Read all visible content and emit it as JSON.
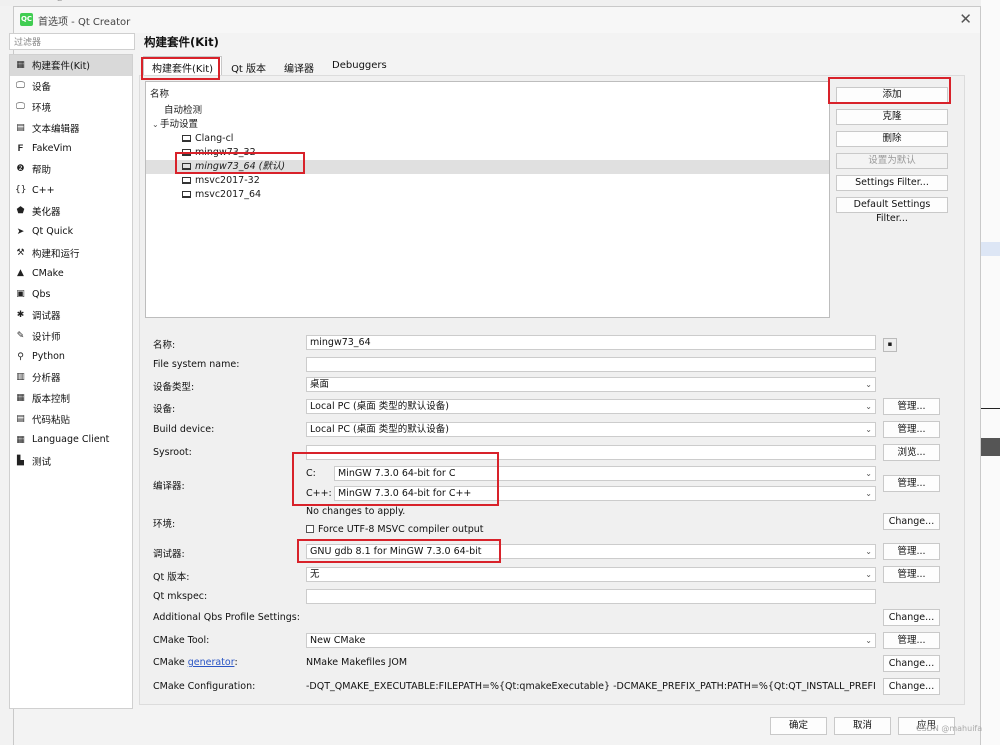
{
  "window": {
    "title": "首选项 - Qt Creator",
    "icon_text": "QC"
  },
  "background": {
    "corner_text": "2"
  },
  "filter": {
    "placeholder": "过滤器"
  },
  "sidebar": {
    "items": [
      {
        "label": "构建套件(Kit)",
        "icon": "▦"
      },
      {
        "label": "设备",
        "icon": "🖵"
      },
      {
        "label": "环境",
        "icon": "🖵"
      },
      {
        "label": "文本编辑器",
        "icon": "▤"
      },
      {
        "label": "FakeVim",
        "icon": "𝐅"
      },
      {
        "label": "帮助",
        "icon": "❷"
      },
      {
        "label": "C++",
        "icon": "{}"
      },
      {
        "label": "美化器",
        "icon": "⬟"
      },
      {
        "label": "Qt Quick",
        "icon": "➤"
      },
      {
        "label": "构建和运行",
        "icon": "⚒"
      },
      {
        "label": "CMake",
        "icon": "▲"
      },
      {
        "label": "Qbs",
        "icon": "▣"
      },
      {
        "label": "调试器",
        "icon": "✱"
      },
      {
        "label": "设计师",
        "icon": "✎"
      },
      {
        "label": "Python",
        "icon": "⚲"
      },
      {
        "label": "分析器",
        "icon": "▥"
      },
      {
        "label": "版本控制",
        "icon": "▦"
      },
      {
        "label": "代码粘贴",
        "icon": "▤"
      },
      {
        "label": "Language Client",
        "icon": "▦"
      },
      {
        "label": "测试",
        "icon": "▙"
      }
    ]
  },
  "page": {
    "title": "构建套件(Kit)"
  },
  "tabs": [
    {
      "label": "构建套件(Kit)"
    },
    {
      "label": "Qt 版本"
    },
    {
      "label": "编译器"
    },
    {
      "label": "Debuggers"
    }
  ],
  "tree": {
    "header": "名称",
    "auto": "自动检测",
    "manual": "手动设置",
    "kits": [
      "Clang-cl",
      "mingw73_32",
      "mingw73_64 (默认)",
      "msvc2017-32",
      "msvc2017_64"
    ]
  },
  "actions": {
    "add": "添加",
    "clone": "克隆",
    "delete": "删除",
    "set_default": "设置为默认",
    "settings_filter": "Settings Filter...",
    "default_settings_filter": "Default Settings Filter..."
  },
  "form": {
    "name_label": "名称:",
    "name_value": "mingw73_64",
    "fs_label": "File system name:",
    "fs_value": "",
    "device_type_label": "设备类型:",
    "device_type_value": "桌面",
    "device_label": "设备:",
    "device_value": "Local PC (桌面 类型的默认设备)",
    "build_device_label": "Build device:",
    "build_device_value": "Local PC (桌面 类型的默认设备)",
    "sysroot_label": "Sysroot:",
    "sysroot_value": "",
    "compiler_label": "编译器:",
    "compiler_c_label": "C:",
    "compiler_c_value": "MinGW 7.3.0 64-bit for C",
    "compiler_cpp_label": "C++:",
    "compiler_cpp_value": "MinGW 7.3.0 64-bit for C++",
    "env_label": "环境:",
    "env_value": "No changes to apply.",
    "force_utf8": "Force UTF-8 MSVC compiler output",
    "debugger_label": "调试器:",
    "debugger_value": "GNU gdb 8.1 for MinGW 7.3.0 64-bit",
    "qtver_label": "Qt 版本:",
    "qtver_value": "无",
    "mkspec_label": "Qt mkspec:",
    "mkspec_value": "",
    "qbs_label": "Additional Qbs Profile Settings:",
    "cmake_tool_label": "CMake Tool:",
    "cmake_tool_value": "New CMake",
    "cmake_gen_label": "CMake",
    "cmake_gen_link": "generator",
    "cmake_gen_colon": ":",
    "cmake_gen_value": "NMake Makefiles JOM",
    "cmake_conf_label": "CMake Configuration:",
    "cmake_conf_value": "-DQT_QMAKE_EXECUTABLE:FILEPATH=%{Qt:qmakeExecutable} -DCMAKE_PREFIX_PATH:PATH=%{Qt:QT_INSTALL_PREFI...",
    "manage": "管理...",
    "browse": "浏览...",
    "change": "Change..."
  },
  "footer": {
    "ok": "确定",
    "cancel": "取消",
    "apply": "应用"
  },
  "watermark": "CSDN @mahuifa",
  "colors": {
    "highlight_red": "#d8222a",
    "selection": "#d9d9d9",
    "link": "#2a55c4"
  }
}
